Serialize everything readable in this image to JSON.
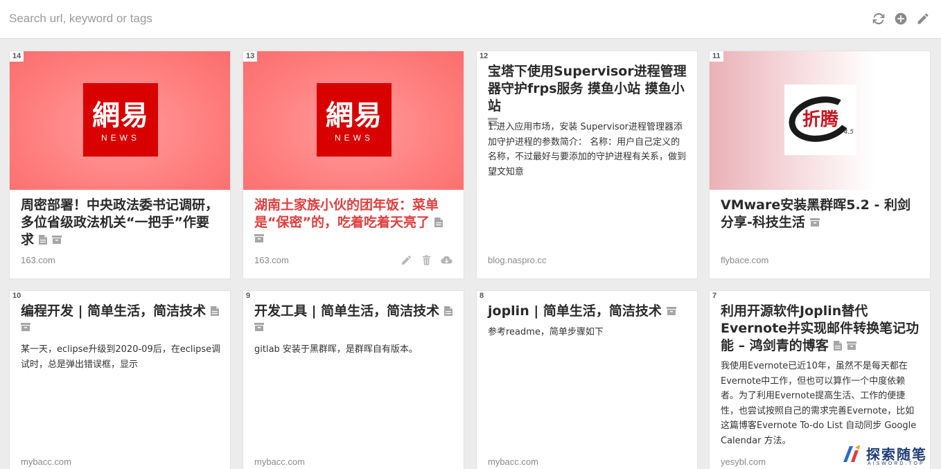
{
  "search": {
    "placeholder": "Search url, keyword or tags",
    "value": ""
  },
  "toolbar": {
    "icons": [
      "refresh-icon",
      "add-circle-icon",
      "pencil-icon"
    ]
  },
  "cards": [
    {
      "id": "14",
      "title": "周密部署！中央政法委书记调研，多位省级政法机关“一把手”作要求",
      "title_color": "#2a2a2a",
      "domain": "163.com",
      "thumbnail": "netease-news-logo",
      "logo_text": "網易",
      "logo_sub": "NEWS",
      "has_note_icon": true,
      "has_archive_icon": true
    },
    {
      "id": "13",
      "title": "湖南土家族小伙的团年饭：菜单是“保密”的，吃着吃着天亮了",
      "title_color": "#e23d3d",
      "domain": "163.com",
      "thumbnail": "netease-news-logo",
      "logo_text": "網易",
      "logo_sub": "NEWS",
      "has_note_icon": true,
      "has_archive_icon": true,
      "actions": [
        "edit-icon",
        "trash-icon",
        "cloud-download-icon"
      ]
    },
    {
      "id": "12",
      "title": "宝塔下使用Supervisor进程管理器守护frps服务 摸鱼小站 摸鱼小站",
      "title_color": "#2a2a2a",
      "excerpt": "1.进入应用市场，安装 Supervisor进程管理器添加守护进程的参数简介： 名称：用户自己定义的名称，不过最好与要添加的守护进程有关系，做到望文知意",
      "domain": "blog.naspro.cc",
      "has_archive_icon": true
    },
    {
      "id": "11",
      "title": "VMware安装黑群晖5.2 - 利剑分享-科技生活",
      "title_color": "#2a2a2a",
      "domain": "flybace.com",
      "thumbnail": "zheteng-logo",
      "logo_text": "折腾",
      "logo_sub": "4.5",
      "has_archive_icon": true
    },
    {
      "id": "10",
      "title": "编程开发 | 简单生活，简洁技术",
      "title_color": "#2a2a2a",
      "excerpt": "某一天，eclipse升级到2020-09后，在eclipse调试时，总是弹出错误框，显示",
      "domain": "mybacc.com",
      "has_note_icon": true,
      "has_archive_icon": true
    },
    {
      "id": "9",
      "title": "开发工具 | 简单生活，简洁技术",
      "title_color": "#2a2a2a",
      "excerpt": "gitlab 安装于黑群晖，是群晖自有版本。",
      "domain": "mybacc.com",
      "has_note_icon": true,
      "has_archive_icon": true
    },
    {
      "id": "8",
      "title": "joplin | 简单生活，简洁技术",
      "title_color": "#2a2a2a",
      "excerpt": "参考readme，简单步骤如下",
      "domain": "mybacc.com",
      "has_archive_icon": true
    },
    {
      "id": "7",
      "title": "利用开源软件Joplin替代Evernote并实现邮件转换笔记功能 – 鸿剑青的博客",
      "title_color": "#2a2a2a",
      "excerpt": "我使用Evernote已近10年，虽然不是每天都在Evernote中工作，但也可以算作一个中度依赖者。为了利用Evernote提高生活、工作的便捷性，也尝试按照自己的需求完善Evernote，比如这篇博客Evernote To-do List 自动同步 Google Calendar 方法。",
      "domain": "yesybl.com",
      "has_note_icon": true,
      "has_archive_icon": true
    }
  ],
  "watermark": {
    "text": "探索随笔",
    "sub": "AISWORD.TOP"
  }
}
